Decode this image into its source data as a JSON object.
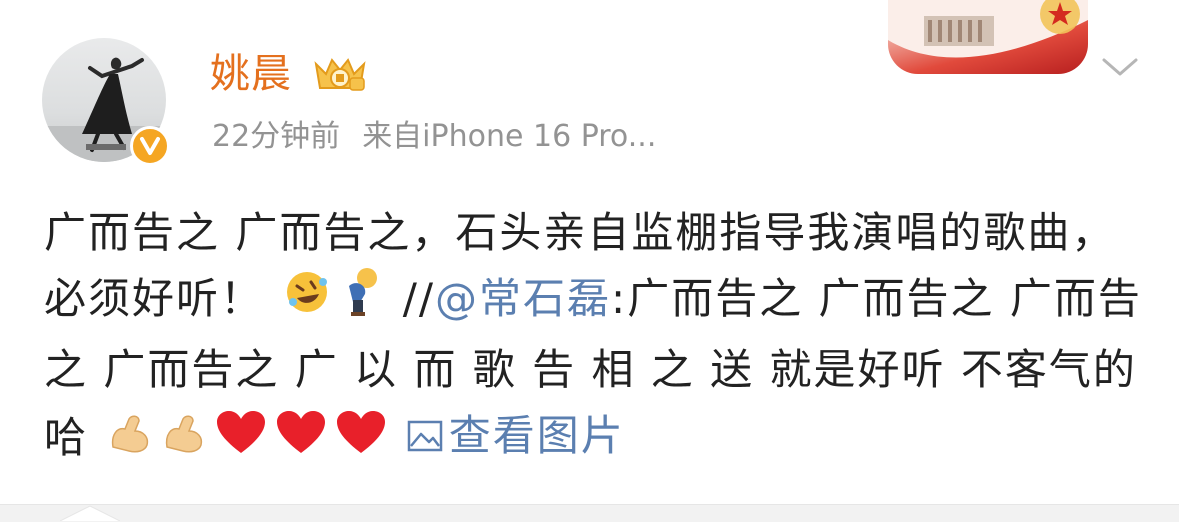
{
  "post": {
    "username": "姚晨",
    "time": "22分钟前",
    "source": "来自iPhone 16 Pro...",
    "text_part1": "广而告之 广而告之，石头亲自监棚指导我演唱的歌曲，必须好听！",
    "repost_prefix": " //",
    "mention": "@常石磊",
    "text_part2": ":广而告之 广而告之 广而告之 广而告之 广 以 而 歌 告 相 之 送 就是好听 不客气的哈",
    "view_image_label": "查看图片"
  },
  "icons": {
    "verified": "verified-v-icon",
    "vip": "vip-crown-badge-icon",
    "menu": "chevron-down-icon",
    "emojis": [
      "rolling-laugh-emoji",
      "bowing-person-emoji",
      "flexed-biceps-emoji",
      "flexed-biceps-emoji",
      "red-heart-emoji",
      "red-heart-emoji",
      "red-heart-emoji"
    ],
    "image_link": "image-icon"
  },
  "colors": {
    "username": "#e4701e",
    "meta": "#939393",
    "link": "#5b7fb0",
    "text": "#222222",
    "verified": "#f5a623"
  }
}
